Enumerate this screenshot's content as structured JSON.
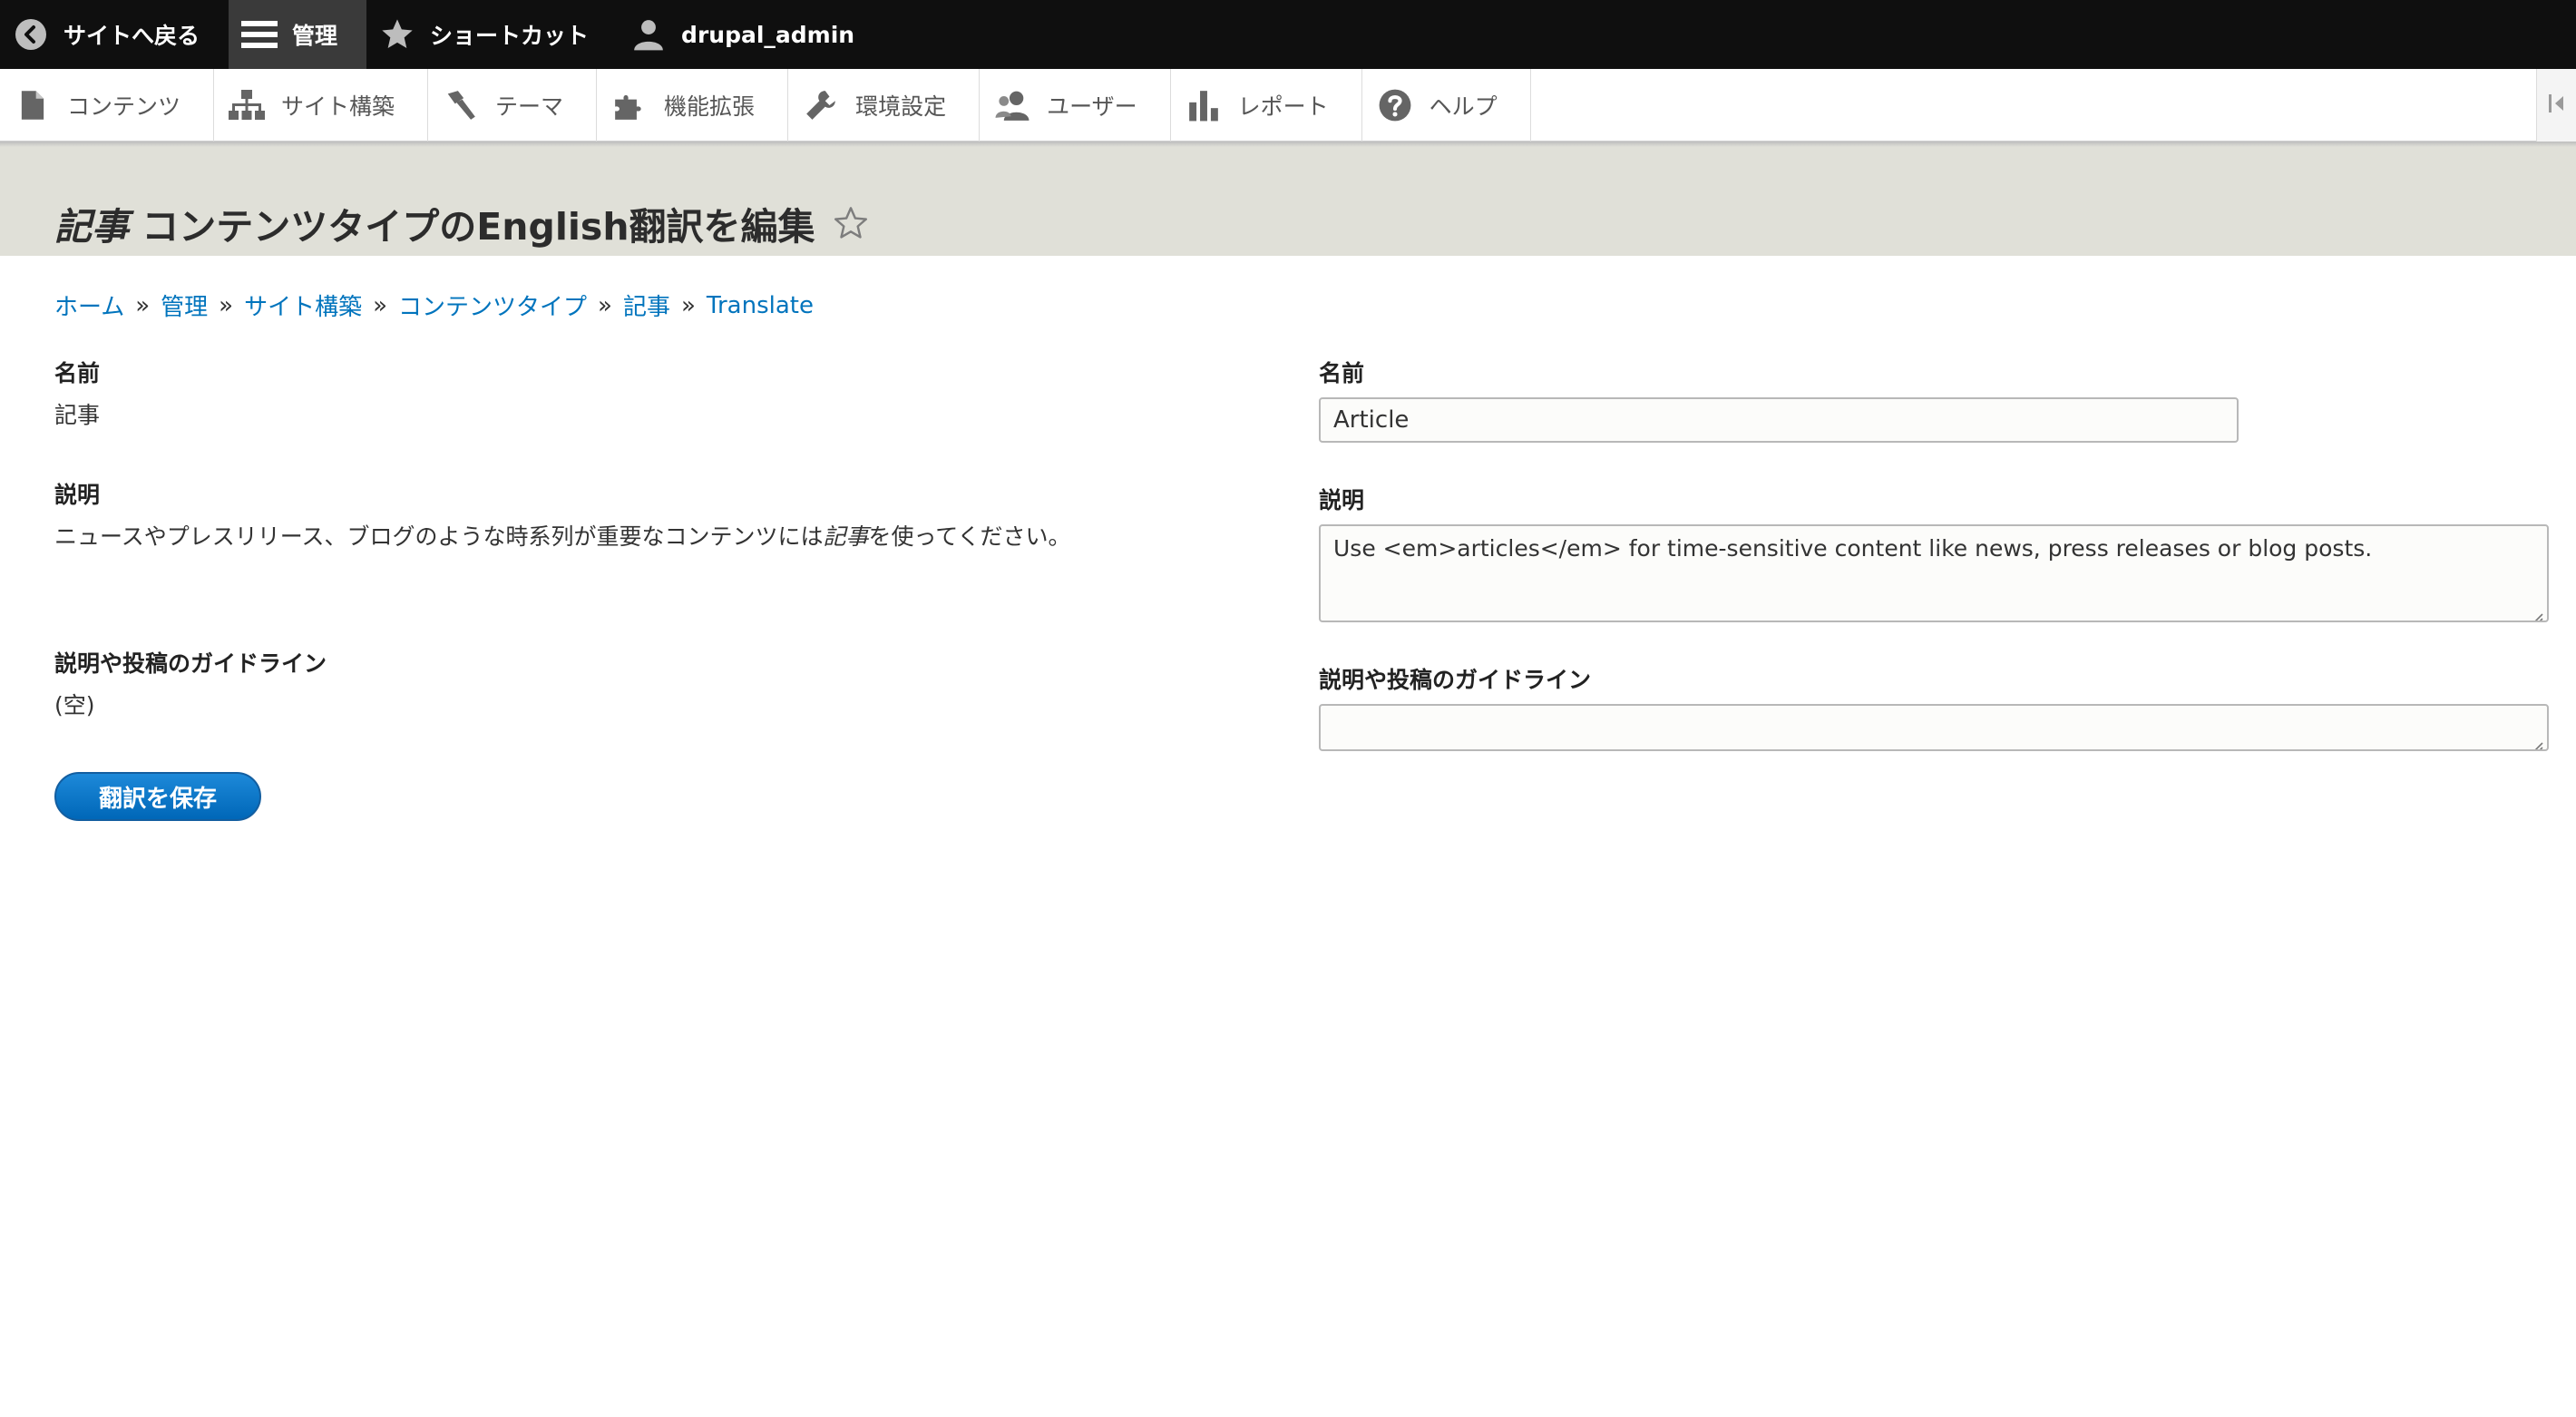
{
  "toolbar": {
    "back_label": "サイトへ戻る",
    "manage_label": "管理",
    "shortcuts_label": "ショートカット",
    "user_label": "drupal_admin"
  },
  "tray": {
    "items": [
      {
        "label": "コンテンツ",
        "icon": "file-icon"
      },
      {
        "label": "サイト構築",
        "icon": "sitemap-icon"
      },
      {
        "label": "テーマ",
        "icon": "paint-icon"
      },
      {
        "label": "機能拡張",
        "icon": "puzzle-icon"
      },
      {
        "label": "環境設定",
        "icon": "wrench-icon"
      },
      {
        "label": "ユーザー",
        "icon": "people-icon"
      },
      {
        "label": "レポート",
        "icon": "bar-chart-icon"
      },
      {
        "label": "ヘルプ",
        "icon": "help-icon"
      }
    ]
  },
  "page": {
    "title_em": "記事",
    "title_rest": " コンテンツタイプのEnglish翻訳を編集"
  },
  "breadcrumb": {
    "items": [
      "ホーム",
      "管理",
      "サイト構築",
      "コンテンツタイプ",
      "記事",
      "Translate"
    ],
    "separator": "»"
  },
  "source": {
    "name_label": "名前",
    "name_value": "記事",
    "description_label": "説明",
    "description_before": "ニュースやプレスリリース、ブログのような時系列が重要なコンテンツには",
    "description_em": "記事",
    "description_after": "を使ってください。",
    "guidelines_label": "説明や投稿のガイドライン",
    "guidelines_value": "(空)"
  },
  "translation": {
    "name_label": "名前",
    "name_value": "Article",
    "description_label": "説明",
    "description_value": "Use <em>articles</em> for time-sensitive content like news, press releases or blog posts.",
    "guidelines_label": "説明や投稿のガイドライン",
    "guidelines_value": ""
  },
  "actions": {
    "save_label": "翻訳を保存"
  },
  "colors": {
    "toolbar_bg": "#0f0f0f",
    "header_bg": "#e0e0d8",
    "link": "#0074bd",
    "primary_button": "#0071c7"
  }
}
